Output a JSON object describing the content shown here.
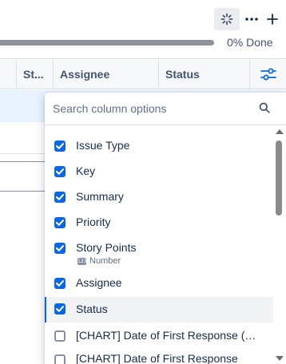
{
  "toolbar": {
    "icons": [
      "loading-sparkle-icon",
      "more-icon",
      "add-icon"
    ]
  },
  "progress": {
    "label": "0% Done",
    "value_percent": 0,
    "track_color": "#8c919a"
  },
  "table_header": {
    "columns": [
      "St...",
      "Assignee",
      "Status"
    ],
    "settings_icon": "column-settings-icon"
  },
  "column_picker": {
    "search_placeholder": "Search column options",
    "options": [
      {
        "label": "Issue Type",
        "checked": true
      },
      {
        "label": "Key",
        "checked": true
      },
      {
        "label": "Summary",
        "checked": true
      },
      {
        "label": "Priority",
        "checked": true
      },
      {
        "label": "Story Points",
        "checked": true,
        "sub_label": "Number",
        "sub_icon": "number-icon"
      },
      {
        "label": "Assignee",
        "checked": true
      },
      {
        "label": "Status",
        "checked": true,
        "selected": true
      },
      {
        "label": "[CHART] Date of First Response (mi...",
        "checked": false
      },
      {
        "label": "[CHART] Date of First Response",
        "checked": false
      }
    ]
  },
  "colors": {
    "accent": "#0c66e4",
    "selected_row_bg": "#f1f2f4",
    "header_bg": "#f7f8f9",
    "highlight_row_bg": "#e9f2ff"
  }
}
